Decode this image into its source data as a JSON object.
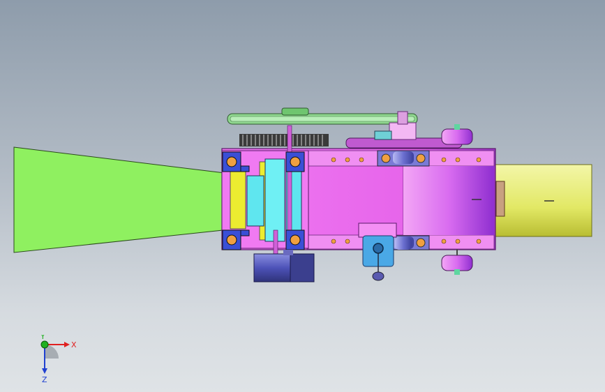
{
  "viewport": {
    "background_top": "#8e9cab",
    "background_bottom": "#dfe3e6"
  },
  "colors": {
    "hopper_green": "#8ff060",
    "housing_magenta": "#ef6cf2",
    "housing_dark": "#b43ec0",
    "belt_yellow": "#e8ee7a",
    "roller_cyan": "#5fe6ef",
    "bearing_blue": "#3a4fd6",
    "gear_gray": "#3a3a3a",
    "motor_indigo": "#4a4fa6",
    "pulley_green": "#8fd68f"
  },
  "triad": {
    "x_label": "X",
    "y_label": "Y",
    "z_label": "Z",
    "x_color": "#e02020",
    "y_color": "#20b020",
    "z_color": "#2040d0"
  }
}
